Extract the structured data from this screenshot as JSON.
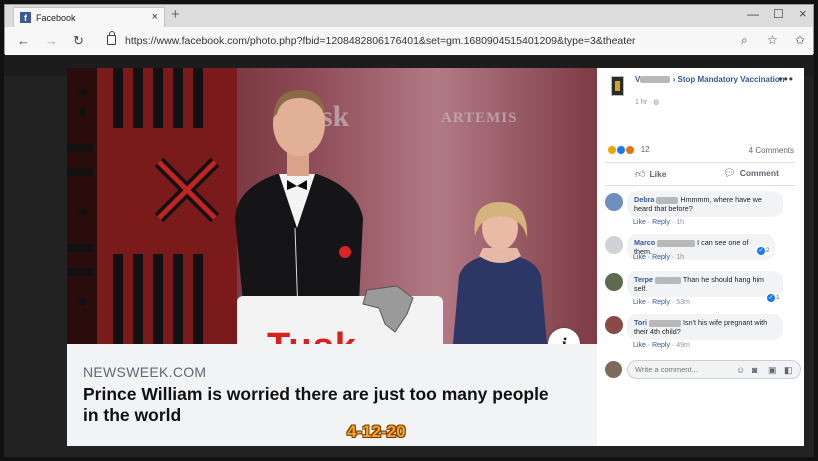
{
  "browser": {
    "tab_title": "Facebook",
    "tab_close": "×",
    "new_tab": "+",
    "url": "https://www.facebook.com/photo.php?fbid=1208482806176401&set=gm.1680904515401209&type=3&theater",
    "minimize": "—",
    "maximize": "☐",
    "close": "×"
  },
  "photo": {
    "background_logo_1": "Tusk",
    "background_logo_2": "ARTEMIS",
    "podium_text": "Tusk",
    "info_button": "i"
  },
  "link_card": {
    "domain": "NEWSWEEK.COM",
    "headline": "Prince William is worried there are just too many people in the world",
    "date_stamp": "4-12-20"
  },
  "post": {
    "author_first_letter": "V",
    "arrow": "›",
    "group_name": "Stop Mandatory Vaccination",
    "time": "1 hr",
    "more": "•••",
    "reaction_count": "12",
    "comment_count": "4 Comments",
    "like_label": "Like",
    "comment_label": "Comment"
  },
  "comments": [
    {
      "name": "Debra",
      "text": "Hmmmm, where have we heard that before?",
      "like": "Like",
      "reply": "Reply",
      "time": "1h",
      "reactions": ""
    },
    {
      "name": "Marco",
      "text": "I can see one of them.",
      "like": "Like",
      "reply": "Reply",
      "time": "1h",
      "reactions": "2"
    },
    {
      "name": "Terpe",
      "text": "Than he should hang him self.",
      "like": "Like",
      "reply": "Reply",
      "time": "53m",
      "reactions": "1"
    },
    {
      "name": "Tori",
      "text": "Isn't his wife pregnant with their 4th child?",
      "like": "Like",
      "reply": "Reply",
      "time": "49m",
      "reactions": ""
    }
  ],
  "composer": {
    "placeholder": "Write a comment..."
  },
  "colors": {
    "fb_blue": "#385898",
    "stamp_orange": "#f5a623",
    "brand_red": "#d8201f"
  }
}
